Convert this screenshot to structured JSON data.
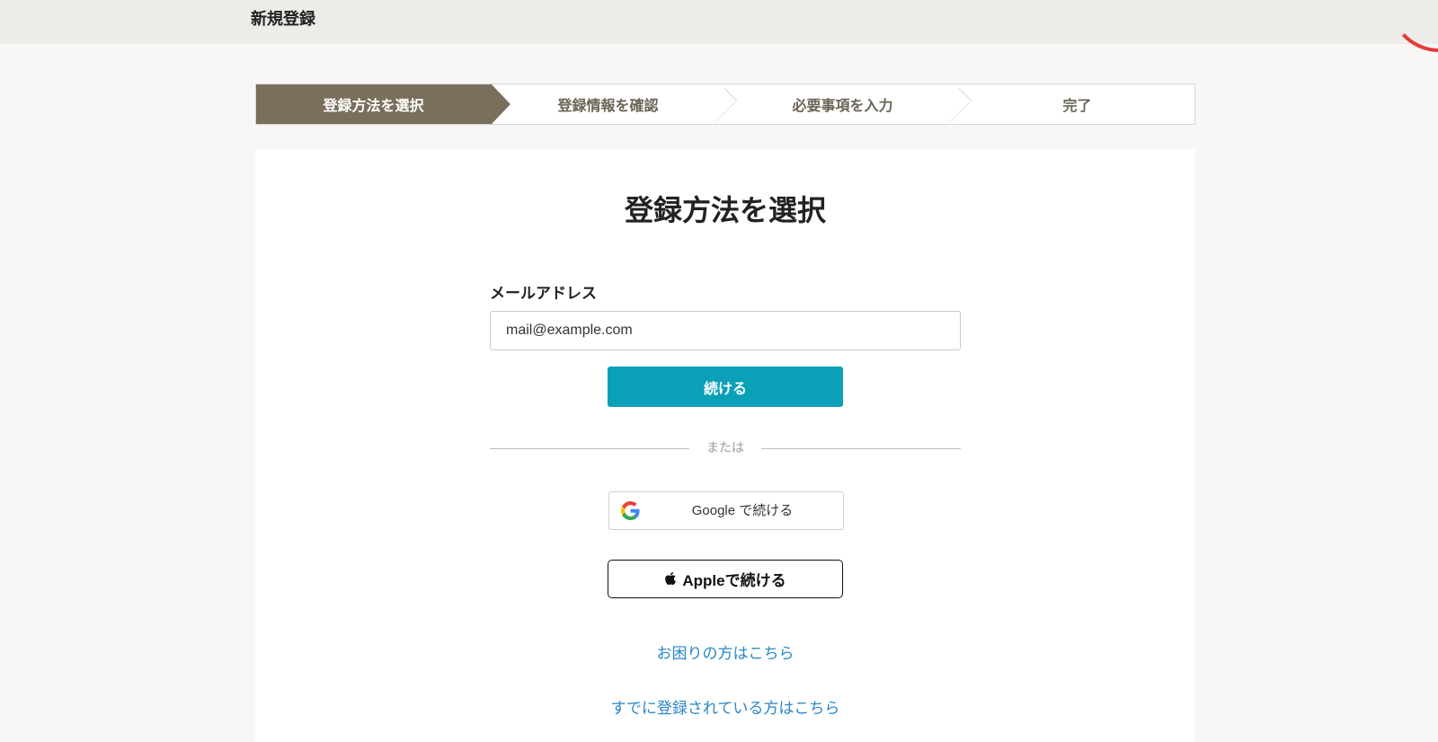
{
  "header": {
    "title": "新規登録"
  },
  "stepper": {
    "steps": [
      {
        "label": "登録方法を選択",
        "active": true
      },
      {
        "label": "登録情報を確認",
        "active": false
      },
      {
        "label": "必要事項を入力",
        "active": false
      },
      {
        "label": "完了",
        "active": false
      }
    ]
  },
  "main": {
    "title": "登録方法を選択",
    "email_label": "メールアドレス",
    "email_placeholder": "mail@example.com",
    "continue_label": "続ける",
    "divider_text": "または",
    "google_label": "Google で続ける",
    "apple_label": "Appleで続ける",
    "help_link": "お困りの方はこちら",
    "login_link": "すでに登録されている方はこちら"
  },
  "colors": {
    "active_step": "#7a6e5c",
    "continue_button": "#0aa0b8",
    "link": "#2b86c5",
    "corner_accent": "#e23b3b"
  },
  "icons": {
    "google": "google-g-logo",
    "apple": "apple-logo"
  }
}
